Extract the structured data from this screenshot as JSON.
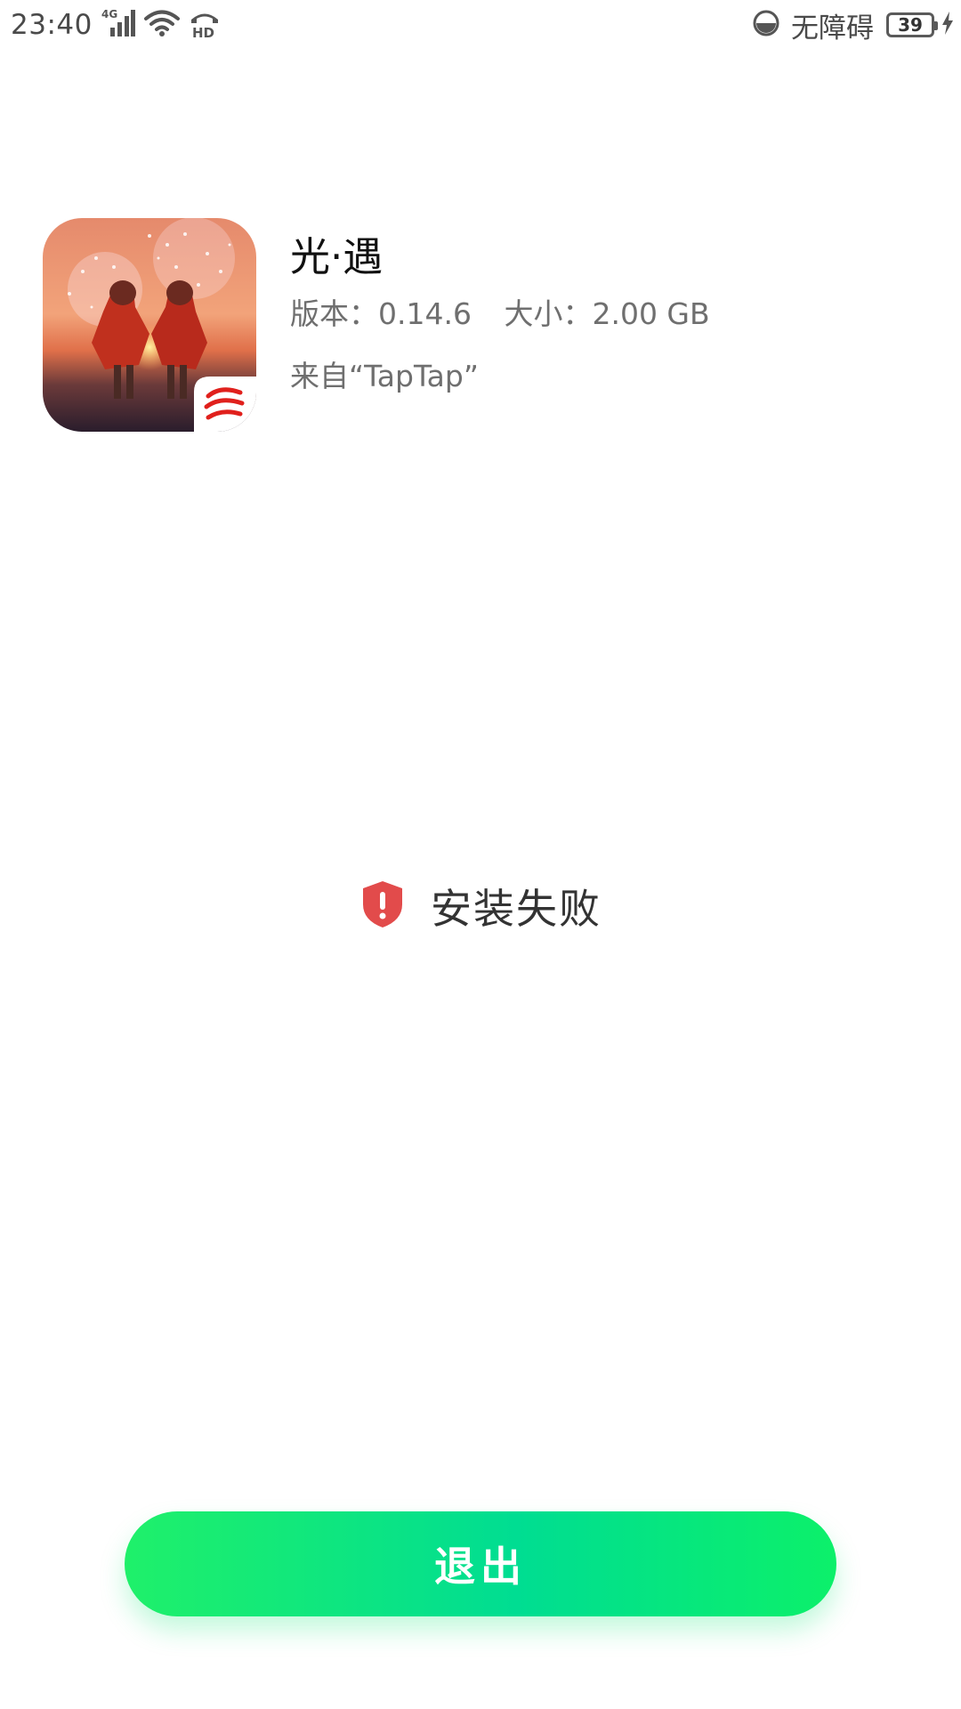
{
  "status_bar": {
    "time": "23:40",
    "network": "4G",
    "hd": "HD",
    "accessibility": "无障碍",
    "battery": "39",
    "icons": [
      "signal-icon",
      "wifi-icon",
      "hd-call-icon",
      "accessibility-icon",
      "battery-icon",
      "charging-icon"
    ]
  },
  "app": {
    "name": "光·遇",
    "version": "版本：0.14.6",
    "size": "大小：2.00 GB",
    "source": "来自“TapTap”",
    "icon": "sky-game-icon"
  },
  "result": {
    "icon": "shield-alert-icon",
    "message": "安装失败",
    "icon_color": "#e24b4b"
  },
  "actions": {
    "exit_label": "退出",
    "button_color": "#00dd92"
  }
}
